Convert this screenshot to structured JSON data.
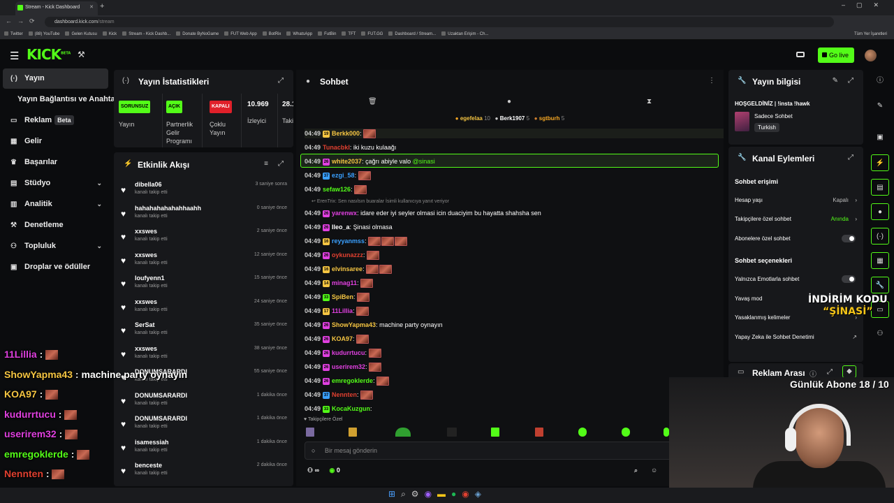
{
  "browser": {
    "tab_title": "Stream - Kick Dashboard",
    "url_domain": "dashboard.kick.com",
    "url_path": "/stream",
    "bookmarks": [
      "Twitter",
      "(88) YouTube",
      "Gelen Kutusu",
      "Kick",
      "Stream - Kick Dashb...",
      "Donate ByNoGame",
      "FUT Web App",
      "BotRix",
      "WhatsApp",
      "FutBin",
      "TFT",
      "FUT.GG",
      "Dashboard / Stream...",
      "Uzaktan Erişim - Ch..."
    ],
    "bookmarks_right": "Tüm Yer İşaretleri"
  },
  "header": {
    "logo": "KICK",
    "logo_badge": "BETA",
    "go_live": "Go live"
  },
  "sidebar": {
    "items": [
      {
        "label": "Yayın",
        "icon": "broadcast-icon"
      },
      {
        "label": "Yayın Bağlantısı ve Anahtarı",
        "icon": ""
      },
      {
        "label": "Reklam",
        "badge": "Beta",
        "icon": "ad-icon"
      },
      {
        "label": "Gelir",
        "icon": "grid-icon"
      },
      {
        "label": "Başarılar",
        "icon": "trophy-icon"
      },
      {
        "label": "Stüdyo",
        "icon": "studio-icon"
      },
      {
        "label": "Analitik",
        "icon": "chart-icon"
      },
      {
        "label": "Denetleme",
        "icon": "hammer-icon"
      },
      {
        "label": "Topluluk",
        "icon": "community-icon"
      },
      {
        "label": "Droplar ve ödüller",
        "icon": "gift-icon"
      }
    ]
  },
  "stats": {
    "title": "Yayın İstatistikleri",
    "items": [
      {
        "pill": "SORUNSUZ",
        "label": "Yayın"
      },
      {
        "pill": "AÇIK",
        "label": "Partnerlik Gelir Programı"
      },
      {
        "pill": "KAPALI",
        "label": "Çoklu Yayın"
      },
      {
        "value": "10.969",
        "label": "İzleyici"
      },
      {
        "value": "28.1",
        "label": "Taki"
      }
    ]
  },
  "activity": {
    "title": "Etkinlik Akışı",
    "rows": [
      {
        "name": "dibella06",
        "sub": "kanalı takip etti",
        "time": "3 saniye sonra"
      },
      {
        "name": "hahahahahahahhaahh",
        "sub": "kanalı takip etti",
        "time": "0 saniye önce"
      },
      {
        "name": "xxswes",
        "sub": "kanalı takip etti",
        "time": "2 saniye önce"
      },
      {
        "name": "xxswes",
        "sub": "kanalı takip etti",
        "time": "12 saniye önce"
      },
      {
        "name": "loufyenn1",
        "sub": "kanalı takip etti",
        "time": "15 saniye önce"
      },
      {
        "name": "xxswes",
        "sub": "kanalı takip etti",
        "time": "24 saniye önce"
      },
      {
        "name": "SerSat",
        "sub": "kanalı takip etti",
        "time": "35 saniye önce"
      },
      {
        "name": "xxswes",
        "sub": "kanalı takip etti",
        "time": "38 saniye önce"
      },
      {
        "name": "DONUMSARARDI",
        "sub": "kanalı takip etti",
        "time": "55 saniye önce"
      },
      {
        "name": "DONUMSARARDI",
        "sub": "kanalı takip etti",
        "time": "1 dakika önce"
      },
      {
        "name": "DONUMSARARDI",
        "sub": "kanalı takip etti",
        "time": "1 dakika önce"
      },
      {
        "name": "isamessiah",
        "sub": "kanalı takip etti",
        "time": "1 dakika önce"
      },
      {
        "name": "benceste",
        "sub": "kanalı takip etti",
        "time": "2 dakika önce"
      }
    ]
  },
  "chat": {
    "title": "Sohbet",
    "pinned": [
      {
        "name": "egefelaa",
        "count": "10"
      },
      {
        "name": "Berk1907",
        "count": "5"
      },
      {
        "name": "sgtburh",
        "count": "5"
      }
    ],
    "reply_hint": "ErenTrix: Sen nasılsın buaralar İsimli kullanıcıya yanıt veriyor",
    "messages": [
      {
        "time": "04:49",
        "lvl": "19",
        "user": "Berkk000",
        "color": "#f5c542",
        "text": "",
        "emotes": 1
      },
      {
        "time": "04:49",
        "lvl": "",
        "user": "Tunacbkl",
        "color": "#e04030",
        "text": "iki kuzu kulaağı",
        "emotes": 0
      },
      {
        "time": "04:49",
        "lvl": "26",
        "user": "white2037",
        "color": "#f5c542",
        "text": "çağrı abiyle valo ",
        "mention": "@sinasi",
        "emotes": 0
      },
      {
        "time": "04:49",
        "lvl": "37",
        "user": "ezgi_58",
        "color": "#3aa0ff",
        "text": "",
        "emotes": 1
      },
      {
        "time": "04:49",
        "lvl": "",
        "user": "sefaw126",
        "color": "#53fc18",
        "text": "",
        "emotes": 1
      },
      {
        "time": "04:49",
        "lvl": "26",
        "user": "yarenwx",
        "color": "#e040e0",
        "text": "idare eder iyi seyler olmasi icin duaciyim bu hayatta shahsha sen",
        "emotes": 0
      },
      {
        "time": "04:49",
        "lvl": "26",
        "user": "lleo_a",
        "color": "#ffffff",
        "text": "Şinasi olmasa",
        "emotes": 0
      },
      {
        "time": "04:49",
        "lvl": "16",
        "user": "reyyanmss",
        "color": "#3aa0ff",
        "text": "",
        "emotes": 3
      },
      {
        "time": "04:49",
        "lvl": "26",
        "user": "oykunazzz",
        "color": "#e04030",
        "text": "",
        "emotes": 1
      },
      {
        "time": "04:49",
        "lvl": "16",
        "user": "elvinsaree",
        "color": "#f5c542",
        "text": "",
        "emotes": 2
      },
      {
        "time": "04:49",
        "lvl": "14",
        "user": "minag11",
        "color": "#e040e0",
        "text": "",
        "emotes": 1
      },
      {
        "time": "04:49",
        "lvl": "33",
        "user": "SpiBen",
        "color": "#f5c542",
        "text": "",
        "emotes": 1
      },
      {
        "time": "04:49",
        "lvl": "17",
        "user": "11Lillia",
        "color": "#e040e0",
        "text": "",
        "emotes": 1
      },
      {
        "time": "04:49",
        "lvl": "26",
        "user": "ShowYapma43",
        "color": "#f5c542",
        "text": "machine party oynayın",
        "emotes": 0
      },
      {
        "time": "04:49",
        "lvl": "26",
        "user": "KOA97",
        "color": "#f5c542",
        "text": "",
        "emotes": 1
      },
      {
        "time": "04:49",
        "lvl": "26",
        "user": "kudurrtucu",
        "color": "#e040e0",
        "text": "",
        "emotes": 1
      },
      {
        "time": "04:49",
        "lvl": "26",
        "user": "userirem32",
        "color": "#e040e0",
        "text": "",
        "emotes": 1
      },
      {
        "time": "04:49",
        "lvl": "26",
        "user": "emregoklerde",
        "color": "#53fc18",
        "text": "",
        "emotes": 1
      },
      {
        "time": "04:49",
        "lvl": "37",
        "user": "Nennten",
        "color": "#e04030",
        "text": "",
        "emotes": 1
      },
      {
        "time": "04:49",
        "lvl": "33",
        "user": "KocaKuzgun",
        "color": "#53fc18",
        "text": "",
        "emotes": 0
      }
    ],
    "followers_only": "Takipçilere Özel",
    "input_placeholder": "Bir mesaj gönderin",
    "bottom_count": "0"
  },
  "stream_info": {
    "title": "Yayın bilgisi",
    "stream_title": "HOŞGELDİNİZ | !insta !hawk",
    "category": "Sadece Sohbet",
    "language": "Turkish"
  },
  "channel_actions": {
    "title": "Kanal Eylemleri",
    "section1": "Sohbet erişimi",
    "rows1": [
      {
        "label": "Hesap yaşı",
        "value": "Kapalı"
      },
      {
        "label": "Takipçilere özel sohbet",
        "value": "Anında"
      },
      {
        "label": "Abonelere özel sohbet",
        "value": ""
      }
    ],
    "section2": "Sohbet seçenekleri",
    "rows2": [
      {
        "label": "Yalnızca Emotlarla sohbet"
      },
      {
        "label": "Yavaş mod"
      },
      {
        "label": "Yasaklanmış kelimeler"
      },
      {
        "label": "Yapay Zeka ile Sohbet Denetimi"
      }
    ]
  },
  "ads": {
    "title": "Reklam Arası"
  },
  "overlay": {
    "lines": [
      {
        "user": "11Lillia",
        "color": "#e040e0",
        "text": ""
      },
      {
        "user": "ShowYapma43",
        "color": "#f5c542",
        "text": "machine party oynayın"
      },
      {
        "user": "KOA97",
        "color": "#f5c542",
        "text": ""
      },
      {
        "user": "kudurrtucu",
        "color": "#e040e0",
        "text": ""
      },
      {
        "user": "userirem32",
        "color": "#e040e0",
        "text": ""
      },
      {
        "user": "emregoklerde",
        "color": "#53fc18",
        "text": ""
      },
      {
        "user": "Nennten",
        "color": "#e04030",
        "text": ""
      }
    ],
    "promo_line1": "İNDİRİM KODU",
    "promo_line2": "“ŞİNASİ”",
    "subs": "Günlük Abone 18 / 10"
  }
}
